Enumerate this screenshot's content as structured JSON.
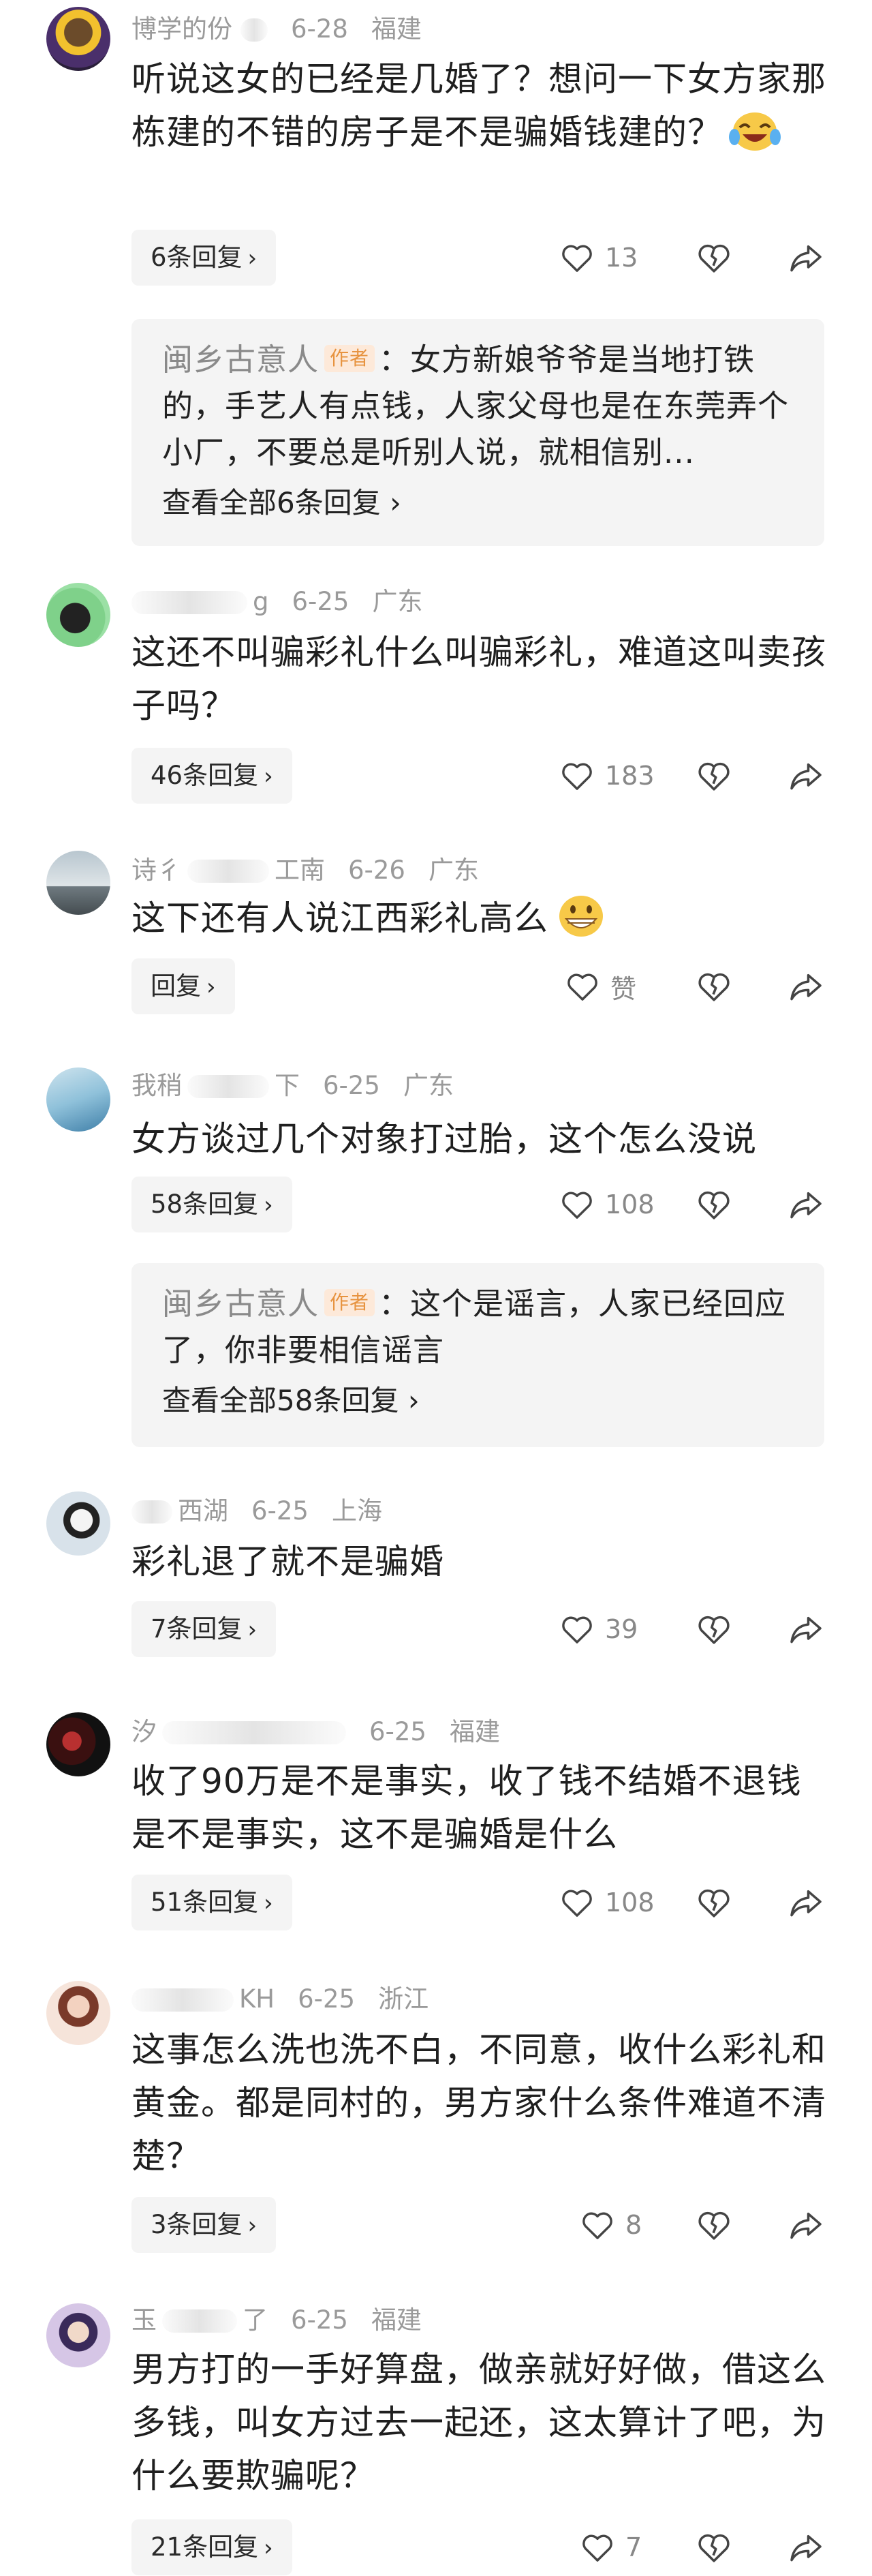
{
  "comments": [
    {
      "username": "博学的份",
      "date": "6-28",
      "location": "福建",
      "text": "听说这女的已经是几婚了？想问一下女方家那栋建的不错的房子是不是骗婚钱建的？",
      "emoji": "laughing-crying-emoji",
      "reply_label": "6条回复",
      "likes": "13",
      "sub_reply": {
        "author": "闽乡古意人",
        "tag": "作者",
        "text": "：女方新娘爷爷是当地打铁的，手艺人有点钱，人家父母也是在东莞弄个小厂，不要总是听别人说，就相信别...",
        "view_all": "查看全部6条回复"
      }
    },
    {
      "username": "g",
      "date": "6-25",
      "location": "广东",
      "text": "这还不叫骗彩礼什么叫骗彩礼，难道这叫卖孩子吗？",
      "reply_label": "46条回复",
      "likes": "183"
    },
    {
      "username": "诗彳",
      "username_suffix": "工南",
      "date": "6-26",
      "location": "广东",
      "text": "这下还有人说江西彩礼高么",
      "emoji": "grinning-emoji",
      "reply_label": "回复",
      "likes": "赞"
    },
    {
      "username": "我稍",
      "username_suffix": "下",
      "date": "6-25",
      "location": "广东",
      "text": "女方谈过几个对象打过胎，这个怎么没说",
      "reply_label": "58条回复",
      "likes": "108",
      "sub_reply": {
        "author": "闽乡古意人",
        "tag": "作者",
        "text": "：这个是谣言，人家已经回应了，你非要相信谣言",
        "view_all": "查看全部58条回复"
      }
    },
    {
      "username": "西湖",
      "date": "6-25",
      "location": "上海",
      "text": "彩礼退了就不是骗婚",
      "reply_label": "7条回复",
      "likes": "39"
    },
    {
      "username": "汐",
      "date": "6-25",
      "location": "福建",
      "text": "收了90万是不是事实，收了钱不结婚不退钱是不是事实，这不是骗婚是什么",
      "reply_label": "51条回复",
      "likes": "108"
    },
    {
      "username": "KH",
      "date": "6-25",
      "location": "浙江",
      "text": "这事怎么洗也洗不白，不同意，收什么彩礼和黄金。都是同村的，男方家什么条件难道不清楚？",
      "reply_label": "3条回复",
      "likes": "8"
    },
    {
      "username": "玉",
      "username_suffix": "了",
      "date": "6-25",
      "location": "福建",
      "text": "男方打的一手好算盘，做亲就好好做，借这么多钱，叫女方过去一起还，这太算计了吧，为什么要欺骗呢？",
      "reply_label": "21条回复",
      "likes": "7"
    }
  ],
  "icons": {
    "like": "heart-outline-icon",
    "dislike": "broken-heart-icon",
    "share": "share-arrow-icon"
  },
  "colors": {
    "meta_gray": "#9a9a9a",
    "reply_bg": "#f4f4f4",
    "author_tag_bg": "#fde9d9",
    "author_tag_text": "#e7933f"
  }
}
